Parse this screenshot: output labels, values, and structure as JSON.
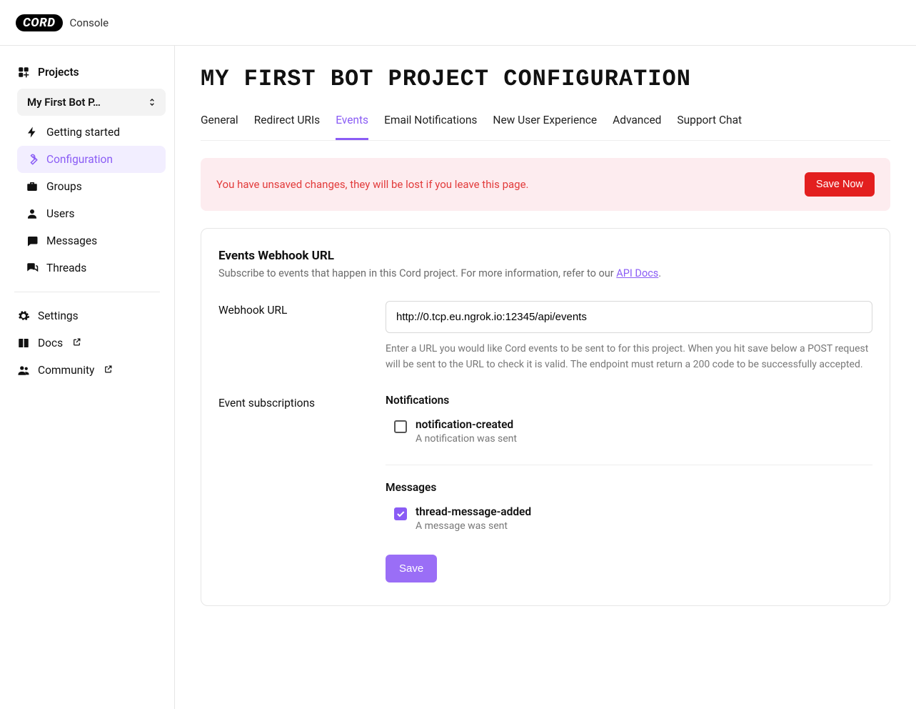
{
  "header": {
    "logo_text": "CORD",
    "console_label": "Console"
  },
  "sidebar": {
    "projects_label": "Projects",
    "selected_project": "My First Bot P…",
    "project_links": [
      {
        "label": "Getting started",
        "icon": "bolt-icon"
      },
      {
        "label": "Configuration",
        "icon": "wrench-icon",
        "active": true
      },
      {
        "label": "Groups",
        "icon": "briefcase-icon"
      },
      {
        "label": "Users",
        "icon": "user-icon"
      },
      {
        "label": "Messages",
        "icon": "message-icon"
      },
      {
        "label": "Threads",
        "icon": "threads-icon"
      }
    ],
    "footer_links": [
      {
        "label": "Settings",
        "icon": "gear-icon"
      },
      {
        "label": "Docs",
        "icon": "book-icon",
        "external": true
      },
      {
        "label": "Community",
        "icon": "people-icon",
        "external": true
      }
    ]
  },
  "page": {
    "title": "MY FIRST BOT PROJECT CONFIGURATION",
    "tabs": [
      "General",
      "Redirect URIs",
      "Events",
      "Email Notifications",
      "New User Experience",
      "Advanced",
      "Support Chat"
    ],
    "active_tab": "Events"
  },
  "alert": {
    "message": "You have unsaved changes, they will be lost if you leave this page.",
    "button": "Save Now"
  },
  "events_card": {
    "title": "Events Webhook URL",
    "subtitle_prefix": "Subscribe to events that happen in this Cord project. For more information, refer to our ",
    "api_docs_label": "API Docs",
    "webhook_label": "Webhook URL",
    "webhook_value": "http://0.tcp.eu.ngrok.io:12345/api/events",
    "webhook_help": "Enter a URL you would like Cord events to be sent to for this project. When you hit save below a POST request will be sent to the URL to check it is valid. The endpoint must return a 200 code to be successfully accepted.",
    "subscriptions_label": "Event subscriptions",
    "groups": [
      {
        "heading": "Notifications",
        "items": [
          {
            "id": "notification-created",
            "desc": "A notification was sent",
            "checked": false
          }
        ]
      },
      {
        "heading": "Messages",
        "items": [
          {
            "id": "thread-message-added",
            "desc": "A message was sent",
            "checked": true
          }
        ]
      }
    ],
    "save_button": "Save"
  }
}
